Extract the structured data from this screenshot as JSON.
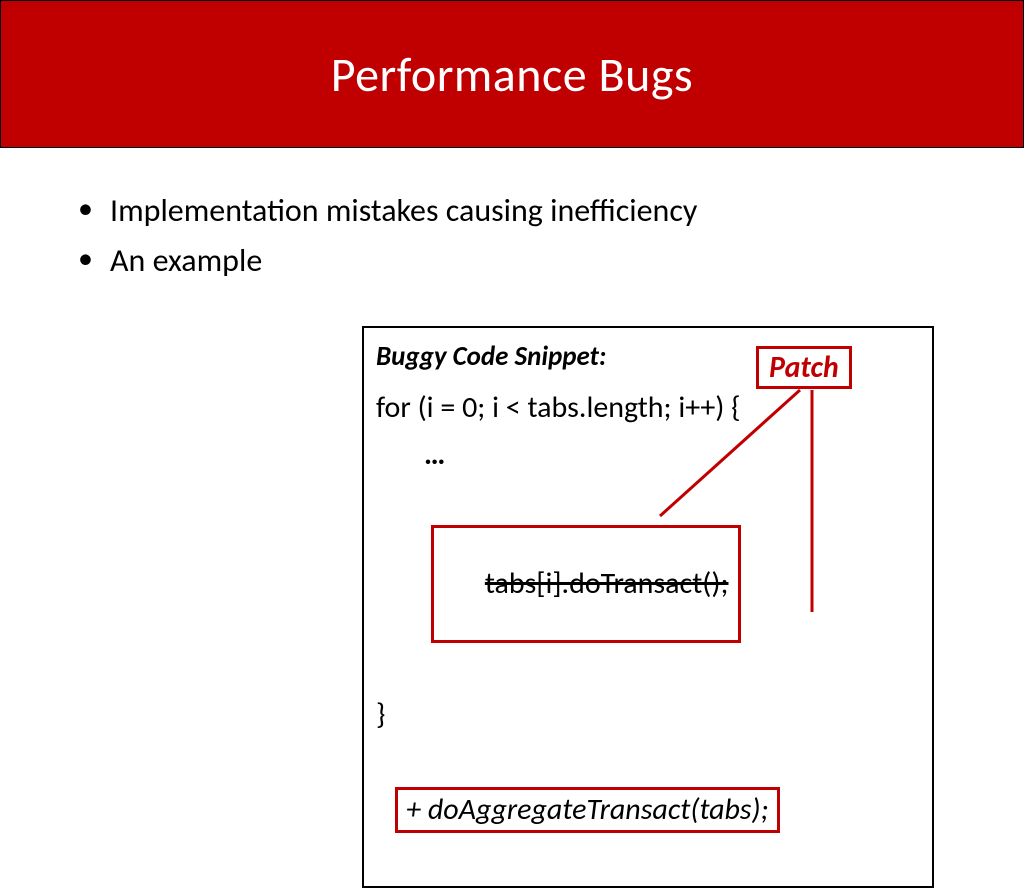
{
  "title": "Performance Bugs",
  "bullets": [
    "Implementation mistakes causing inefficiency",
    "An example"
  ],
  "code": {
    "heading": "Buggy Code Snippet:",
    "line_for": "for (i = 0; i < tabs.length; i++) {",
    "ellipsis": "…",
    "removed": "tabs[i].doTransact();",
    "close_brace": "}",
    "added": "+ doAggregateTransact(tabs);"
  },
  "patch_label": "Patch"
}
